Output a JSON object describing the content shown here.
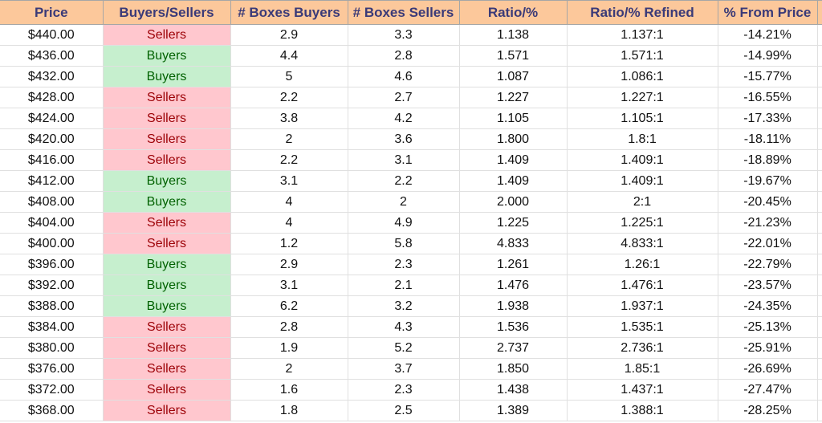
{
  "table": {
    "headers": [
      "Price",
      "Buyers/Sellers",
      "# Boxes Buyers",
      "# Boxes Sellers",
      "Ratio/%",
      "Ratio/% Refined",
      "% From Price"
    ],
    "colors": {
      "header_bg": "#fcc89b",
      "header_text": "#3a3a78",
      "sellers_bg": "#ffc7ce",
      "sellers_text": "#9c0006",
      "buyers_bg": "#c6efce",
      "buyers_text": "#006100"
    },
    "rows": [
      {
        "price": "$440.00",
        "side": "Sellers",
        "boxes_buyers": "2.9",
        "boxes_sellers": "3.3",
        "ratio": "1.138",
        "ratio_refined": "1.137:1",
        "pct_from_price": "-14.21%"
      },
      {
        "price": "$436.00",
        "side": "Buyers",
        "boxes_buyers": "4.4",
        "boxes_sellers": "2.8",
        "ratio": "1.571",
        "ratio_refined": "1.571:1",
        "pct_from_price": "-14.99%"
      },
      {
        "price": "$432.00",
        "side": "Buyers",
        "boxes_buyers": "5",
        "boxes_sellers": "4.6",
        "ratio": "1.087",
        "ratio_refined": "1.086:1",
        "pct_from_price": "-15.77%"
      },
      {
        "price": "$428.00",
        "side": "Sellers",
        "boxes_buyers": "2.2",
        "boxes_sellers": "2.7",
        "ratio": "1.227",
        "ratio_refined": "1.227:1",
        "pct_from_price": "-16.55%"
      },
      {
        "price": "$424.00",
        "side": "Sellers",
        "boxes_buyers": "3.8",
        "boxes_sellers": "4.2",
        "ratio": "1.105",
        "ratio_refined": "1.105:1",
        "pct_from_price": "-17.33%"
      },
      {
        "price": "$420.00",
        "side": "Sellers",
        "boxes_buyers": "2",
        "boxes_sellers": "3.6",
        "ratio": "1.800",
        "ratio_refined": "1.8:1",
        "pct_from_price": "-18.11%"
      },
      {
        "price": "$416.00",
        "side": "Sellers",
        "boxes_buyers": "2.2",
        "boxes_sellers": "3.1",
        "ratio": "1.409",
        "ratio_refined": "1.409:1",
        "pct_from_price": "-18.89%"
      },
      {
        "price": "$412.00",
        "side": "Buyers",
        "boxes_buyers": "3.1",
        "boxes_sellers": "2.2",
        "ratio": "1.409",
        "ratio_refined": "1.409:1",
        "pct_from_price": "-19.67%"
      },
      {
        "price": "$408.00",
        "side": "Buyers",
        "boxes_buyers": "4",
        "boxes_sellers": "2",
        "ratio": "2.000",
        "ratio_refined": "2:1",
        "pct_from_price": "-20.45%"
      },
      {
        "price": "$404.00",
        "side": "Sellers",
        "boxes_buyers": "4",
        "boxes_sellers": "4.9",
        "ratio": "1.225",
        "ratio_refined": "1.225:1",
        "pct_from_price": "-21.23%"
      },
      {
        "price": "$400.00",
        "side": "Sellers",
        "boxes_buyers": "1.2",
        "boxes_sellers": "5.8",
        "ratio": "4.833",
        "ratio_refined": "4.833:1",
        "pct_from_price": "-22.01%"
      },
      {
        "price": "$396.00",
        "side": "Buyers",
        "boxes_buyers": "2.9",
        "boxes_sellers": "2.3",
        "ratio": "1.261",
        "ratio_refined": "1.26:1",
        "pct_from_price": "-22.79%"
      },
      {
        "price": "$392.00",
        "side": "Buyers",
        "boxes_buyers": "3.1",
        "boxes_sellers": "2.1",
        "ratio": "1.476",
        "ratio_refined": "1.476:1",
        "pct_from_price": "-23.57%"
      },
      {
        "price": "$388.00",
        "side": "Buyers",
        "boxes_buyers": "6.2",
        "boxes_sellers": "3.2",
        "ratio": "1.938",
        "ratio_refined": "1.937:1",
        "pct_from_price": "-24.35%"
      },
      {
        "price": "$384.00",
        "side": "Sellers",
        "boxes_buyers": "2.8",
        "boxes_sellers": "4.3",
        "ratio": "1.536",
        "ratio_refined": "1.535:1",
        "pct_from_price": "-25.13%"
      },
      {
        "price": "$380.00",
        "side": "Sellers",
        "boxes_buyers": "1.9",
        "boxes_sellers": "5.2",
        "ratio": "2.737",
        "ratio_refined": "2.736:1",
        "pct_from_price": "-25.91%"
      },
      {
        "price": "$376.00",
        "side": "Sellers",
        "boxes_buyers": "2",
        "boxes_sellers": "3.7",
        "ratio": "1.850",
        "ratio_refined": "1.85:1",
        "pct_from_price": "-26.69%"
      },
      {
        "price": "$372.00",
        "side": "Sellers",
        "boxes_buyers": "1.6",
        "boxes_sellers": "2.3",
        "ratio": "1.438",
        "ratio_refined": "1.437:1",
        "pct_from_price": "-27.47%"
      },
      {
        "price": "$368.00",
        "side": "Sellers",
        "boxes_buyers": "1.8",
        "boxes_sellers": "2.5",
        "ratio": "1.389",
        "ratio_refined": "1.388:1",
        "pct_from_price": "-28.25%"
      }
    ]
  }
}
